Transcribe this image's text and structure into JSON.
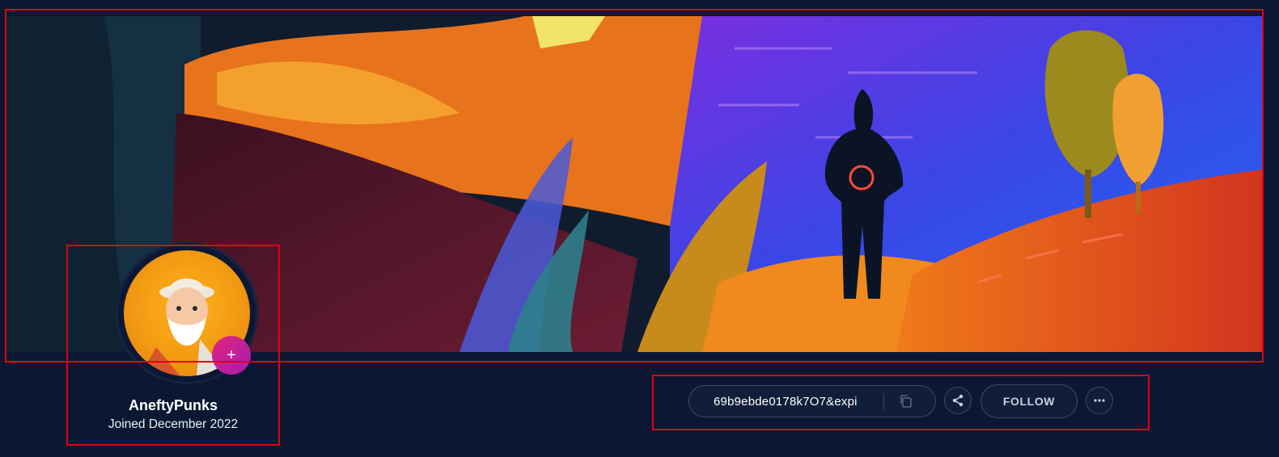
{
  "profile": {
    "username": "AneftyPunks",
    "joined": "Joined December 2022",
    "add_label": "+"
  },
  "actions": {
    "address": "69b9ebde0178k7O7&expi",
    "follow_label": "FOLLOW",
    "icons": [
      "copy-icon",
      "share-icon",
      "more-icon",
      "plus-icon"
    ]
  },
  "colors": {
    "page_background": "#0c1833",
    "accent": "#d6217f",
    "outline": "#e00012"
  }
}
